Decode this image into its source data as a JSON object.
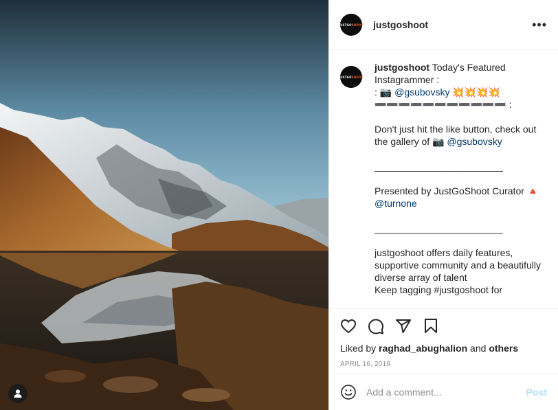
{
  "post": {
    "username": "justgoshoot",
    "avatar_logo": {
      "part1": "JUSTGO",
      "part2": "SHOOT"
    },
    "more_icon": "more-horizontal-icon",
    "caption": {
      "username": "justgoshoot",
      "line1": " Today's Featured Instagrammer :",
      "line2_prefix": ": 📷 ",
      "mention1": "@gsubovsky",
      "line2_suffix": " 💥💥💥💥",
      "line3": "➖➖➖➖➖➖➖➖➖➖➖ :",
      "para2": "Don't just hit the like button, check out the gallery of 📷 ",
      "mention2": "@gsubovsky",
      "divider1": "________________________",
      "para3": "Presented by JustGoShoot Curator 🔺 ",
      "mention3": "@turnone",
      "divider2": "________________________",
      "para4": "justgoshoot offers daily features, supportive community and a beautifully diverse array of talent",
      "para4_cut": "Keep tagging #justgoshoot for"
    },
    "likes": {
      "prefix": "Liked by ",
      "user": "raghad_abughalion",
      "middle": " and ",
      "others": "others"
    },
    "date": "APRIL 16, 2019",
    "comment": {
      "placeholder": "Add a comment...",
      "post_label": "Post"
    },
    "icons": {
      "like": "heart-icon",
      "comment": "comment-bubble-icon",
      "share": "paper-plane-icon",
      "save": "bookmark-icon",
      "emoji": "emoji-smile-icon",
      "user_tag": "user-tag-icon"
    },
    "colors": {
      "link": "#00376b",
      "post_button": "#b2dffc",
      "muted": "#8e8e8e",
      "logo_accent": "#e85d2a"
    }
  }
}
